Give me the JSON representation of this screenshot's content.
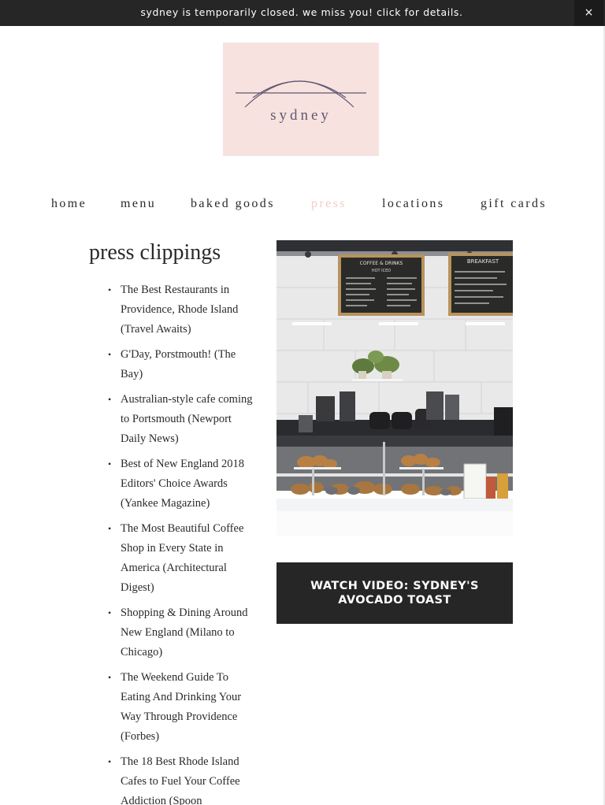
{
  "announcement": {
    "text": "sydney is temporarily closed. we miss you! click for details.",
    "close_label": "×"
  },
  "logo": {
    "text": "sydney",
    "background": "#f8e2df"
  },
  "nav": {
    "items": [
      {
        "label": "home"
      },
      {
        "label": "menu"
      },
      {
        "label": "baked goods"
      },
      {
        "label": "press"
      },
      {
        "label": "locations"
      },
      {
        "label": "gift cards"
      }
    ],
    "active_color": "#f3ccc8"
  },
  "press": {
    "heading": "press clippings",
    "bullet": "•",
    "clippings": [
      "The Best Restaurants in Providence, Rhode Island (Travel Awaits)",
      "G'Day, Porstmouth! (The Bay)",
      "Australian-style cafe coming to Portsmouth (Newport Daily News)",
      "Best of New England 2018 Editors' Choice Awards (Yankee Magazine)",
      "The Most Beautiful Coffee Shop in Every State in America (Architectural Digest)",
      "Shopping & Dining Around New England (Milano to Chicago)",
      "The Weekend Guide To Eating And Drinking Your Way Through Providence (Forbes)",
      "The 18 Best Rhode Island Cafes to Fuel Your Coffee Addiction (Spoon"
    ]
  },
  "photo": {
    "menu_boards": [
      "COFFEE & DRINKS",
      "BREAKFAST"
    ],
    "board_sub": "HOT  ICED"
  },
  "video_button": {
    "label": "WATCH VIDEO: SYDNEY'S AVOCADO TOAST"
  },
  "colors": {
    "dark": "#262626",
    "accent_pink": "#f8e2df",
    "text": "#2a2a2a"
  }
}
